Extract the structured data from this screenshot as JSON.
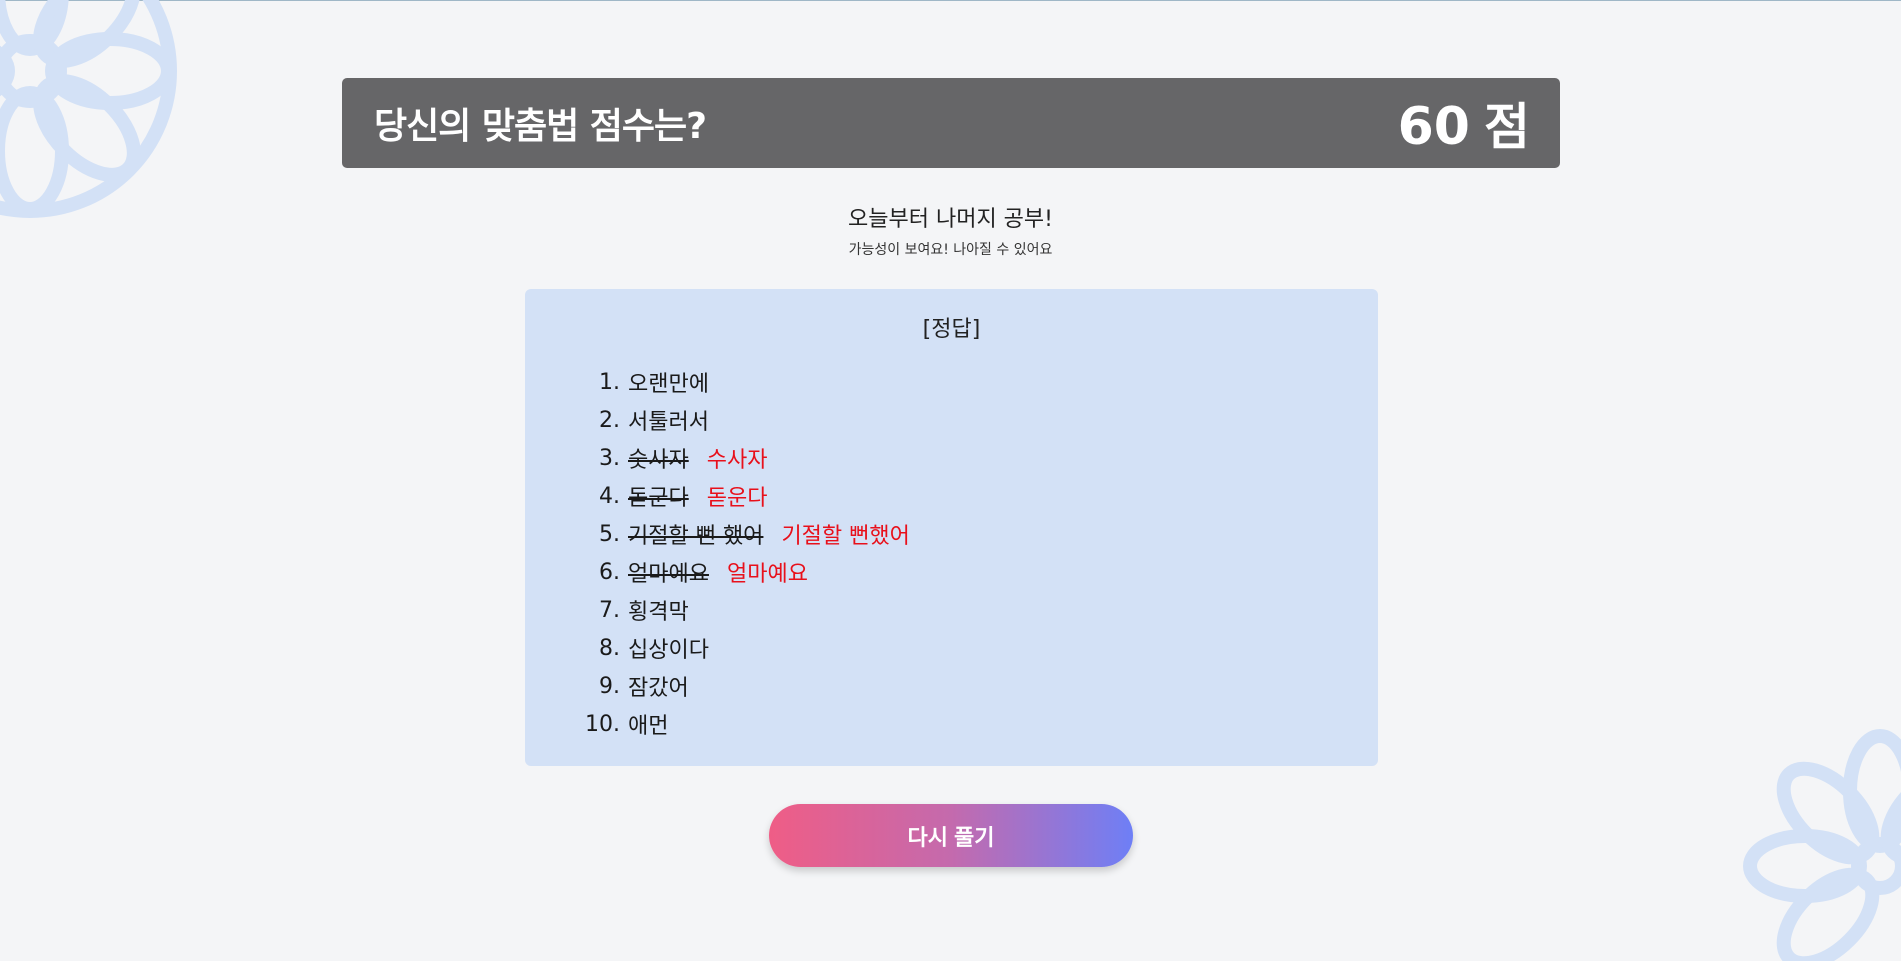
{
  "header": {
    "title": "당신의 맞춤법 점수는?",
    "score": "60",
    "score_unit": "점"
  },
  "result": {
    "message": "오늘부터 나머지 공부!",
    "sub_message": "가능성이 보여요! 나아질 수 있어요"
  },
  "answers": {
    "heading": "[정답]",
    "items": [
      {
        "num": "1.",
        "text": "오랜만에",
        "correct": ""
      },
      {
        "num": "2.",
        "text": "서툴러서",
        "correct": ""
      },
      {
        "num": "3.",
        "text": "숫사자",
        "correct": "수사자"
      },
      {
        "num": "4.",
        "text": "돋군다",
        "correct": "돋운다"
      },
      {
        "num": "5.",
        "text": "기절할 뻔 했어",
        "correct": "기절할 뻔했어"
      },
      {
        "num": "6.",
        "text": "얼마에요",
        "correct": "얼마예요"
      },
      {
        "num": "7.",
        "text": "횡격막",
        "correct": ""
      },
      {
        "num": "8.",
        "text": "십상이다",
        "correct": ""
      },
      {
        "num": "9.",
        "text": "잠갔어",
        "correct": ""
      },
      {
        "num": "10.",
        "text": "애먼",
        "correct": ""
      }
    ]
  },
  "actions": {
    "retry_label": "다시 풀기"
  },
  "colors": {
    "score_bar": "#666668",
    "answer_box": "#d3e1f6",
    "correction": "#e8101b",
    "button_start": "#ef5d86",
    "button_end": "#6e7ff6",
    "decoration": "#d3e1f6"
  }
}
